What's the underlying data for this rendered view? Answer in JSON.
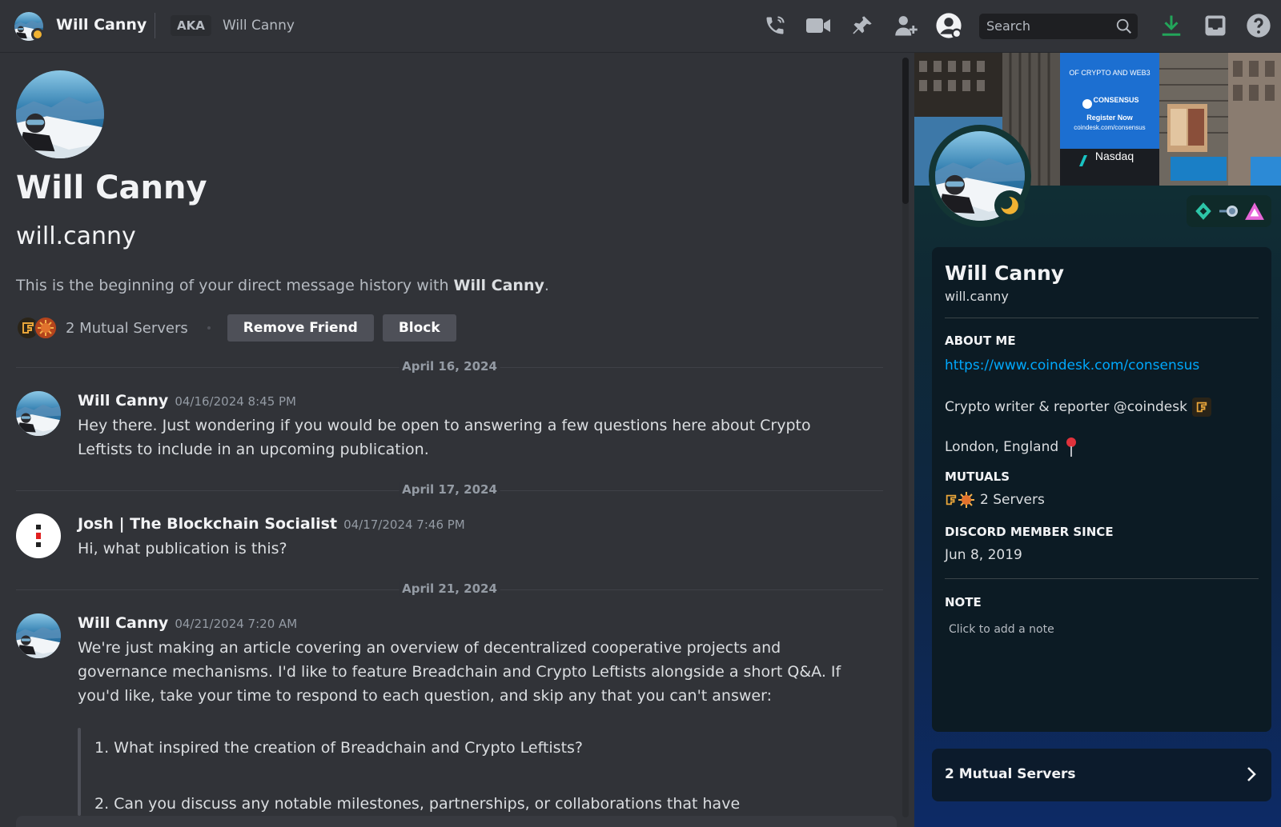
{
  "topbar": {
    "name": "Will Canny",
    "aka_label": "AKA",
    "aka_name": "Will Canny",
    "search_placeholder": "Search",
    "icons": [
      "phone-icon",
      "video-icon",
      "pin-icon",
      "add-friend-icon",
      "profile-toggle-icon",
      "search-icon",
      "download-icon",
      "inbox-icon",
      "help-icon"
    ]
  },
  "header": {
    "display_name": "Will Canny",
    "username": "will.canny",
    "intro_prefix": "This is the beginning of your direct message history with ",
    "intro_name": "Will Canny",
    "intro_suffix": ".",
    "mutual_servers": "2 Mutual Servers",
    "remove_friend": "Remove Friend",
    "block": "Block"
  },
  "messages": {
    "d1": "April 16, 2024",
    "m1_author": "Will Canny",
    "m1_time": "04/16/2024 8:45 PM",
    "m1_line1": "Hey there. Just wondering if you would be open to answering a few questions here about Crypto",
    "m1_line2": "Leftists to include in an upcoming publication.",
    "d2": "April 17, 2024",
    "m2_author": "Josh | The Blockchain Socialist",
    "m2_time": "04/17/2024 7:46 PM",
    "m2_line1": "Hi, what publication is this?",
    "d3": "April 21, 2024",
    "m3_author": "Will Canny",
    "m3_time": "04/21/2024 7:20 AM",
    "m3_line1": "We're just making an article covering an overview of decentralized cooperative projects and",
    "m3_line2": "governance mechanisms. I'd like to feature Breadchain and Crypto Leftists alongside a short Q&A. If",
    "m3_line3": "you'd like, take your time to respond to each question, and skip any that you can't answer:",
    "q1": "1. What inspired the creation of Breadchain and Crypto Leftists?",
    "q2": "2. Can you discuss any notable milestones, partnerships, or collaborations that have"
  },
  "profile": {
    "display_name": "Will Canny",
    "username": "will.canny",
    "about_heading": "ABOUT ME",
    "about_link": "https://www.coindesk.com/consensus",
    "about_line1": "Crypto writer & reporter @coindesk",
    "about_line2": "London, England",
    "mutuals_heading": "MUTUALS",
    "mutuals_value": "2 Servers",
    "member_since_heading": "DISCORD MEMBER SINCE",
    "member_since_value": "Jun 8, 2019",
    "note_heading": "NOTE",
    "note_placeholder": "Click to add a note",
    "mutual_servers_card": "2 Mutual Servers"
  },
  "banner_text": {
    "sign_top": "OF CRYPTO AND WEB3",
    "sign_brand": "CONSENSUS",
    "sign_cta": "Register Now",
    "sign_url": "coindesk.com/consensus",
    "exchange": "Nasdaq"
  },
  "colors": {
    "background": "#313338",
    "accent_link": "#00a8fc",
    "status_idle": "#f0b232",
    "download_green": "#23a55a"
  }
}
